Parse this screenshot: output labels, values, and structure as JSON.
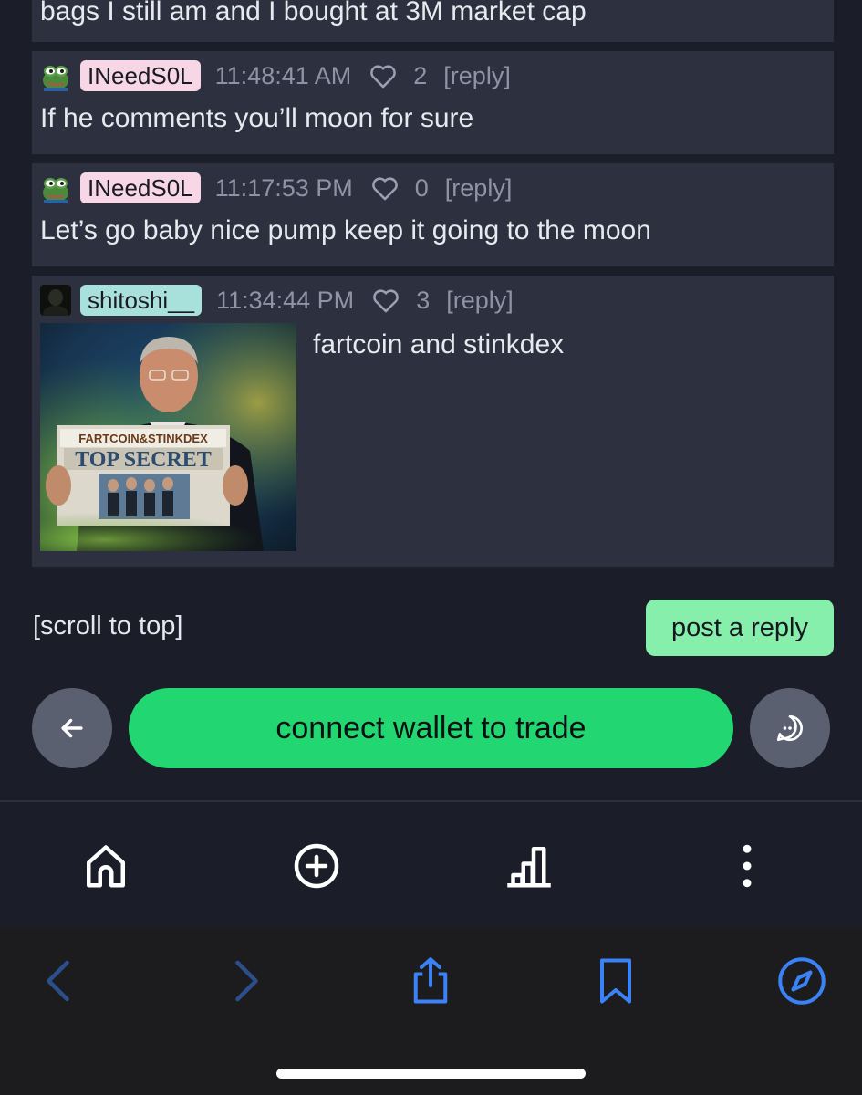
{
  "comments": [
    {
      "body": "bags I still am and I bought at 3M market cap"
    },
    {
      "username": "INeedS0L",
      "username_color": "#f7d6e6",
      "avatar_icon": "pepe-frog-icon",
      "time": "11:48:41 AM",
      "likes": "2",
      "reply_label": "[reply]",
      "body": "If he comments you’ll moon for sure"
    },
    {
      "username": "INeedS0L",
      "username_color": "#f7d6e6",
      "avatar_icon": "pepe-frog-icon",
      "time": "11:17:53 PM",
      "likes": "0",
      "reply_label": "[reply]",
      "body": "Let’s go baby nice pump keep it going to the moon"
    },
    {
      "username": "shitoshi__",
      "username_color": "#a8e0dc",
      "avatar_icon": "dark-avatar-icon",
      "time": "11:34:44 PM",
      "likes": "3",
      "reply_label": "[reply]",
      "body": "fartcoin and stinkdex",
      "image": {
        "headline_top": "FARTCOIN&STINKDEX",
        "headline_main": "TOP SECRET"
      }
    }
  ],
  "footer": {
    "scroll_to_top": "[scroll to top]",
    "post_reply": "post a reply",
    "connect_wallet": "connect wallet to trade"
  },
  "colors": {
    "accent_green": "#22d672",
    "reply_button": "#86efac",
    "browser_blue": "#3b82f6"
  },
  "app_nav": [
    "home-icon",
    "add-circle-icon",
    "bar-chart-icon",
    "more-vertical-icon"
  ],
  "browser_toolbar": [
    "back-chevron-icon",
    "forward-chevron-icon",
    "share-icon",
    "bookmark-icon",
    "compass-icon"
  ]
}
